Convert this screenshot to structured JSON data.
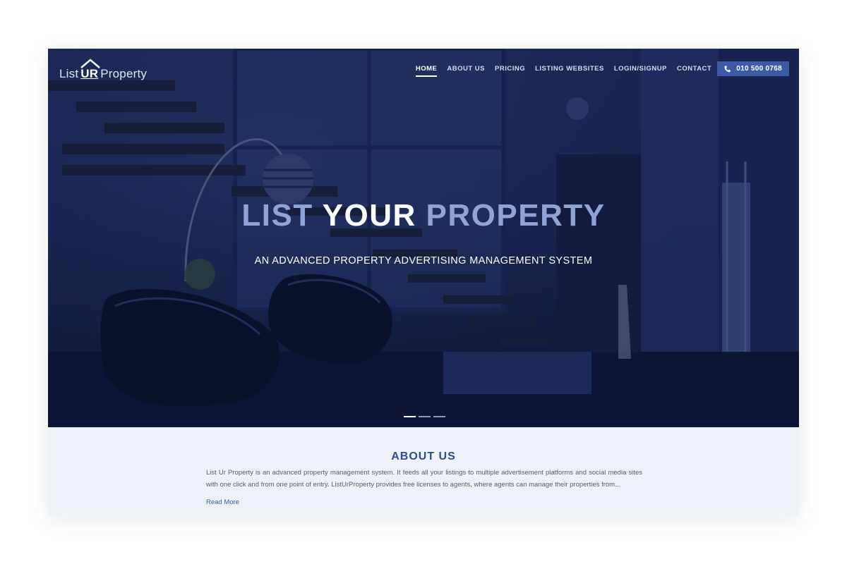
{
  "brand": {
    "logo_prefix": "List",
    "logo_highlight": "UR",
    "logo_suffix": "Property"
  },
  "nav": {
    "items": [
      {
        "label": "HOME",
        "active": true
      },
      {
        "label": "ABOUT US",
        "active": false
      },
      {
        "label": "PRICING",
        "active": false
      },
      {
        "label": "LISTING WEBSITES",
        "active": false
      },
      {
        "label": "LOGIN/SIGNUP",
        "active": false
      },
      {
        "label": "CONTACT",
        "active": false
      }
    ],
    "phone": "010 500 0768",
    "phone_icon": "phone-icon"
  },
  "hero": {
    "title_part1": "LIST",
    "title_part2": "YOUR",
    "title_part3": "PROPERTY",
    "subtitle": "AN ADVANCED PROPERTY ADVERTISING MANAGEMENT SYSTEM",
    "slides": 3,
    "active_slide": 1
  },
  "about": {
    "heading": "ABOUT US",
    "text": "List Ur Property is an advanced property management system. It feeds all your listings to multiple advertisement platforms and social media sites with one click and from one point of entry. ListUrProperty provides free licenses to agents, where agents can manage their properties from...",
    "read_more": "Read More"
  },
  "colors": {
    "accent": "#3c5aa6",
    "heading": "#2f4b8f",
    "hero_overlay": "#1e2a55",
    "section_bg": "#eef1f8"
  }
}
